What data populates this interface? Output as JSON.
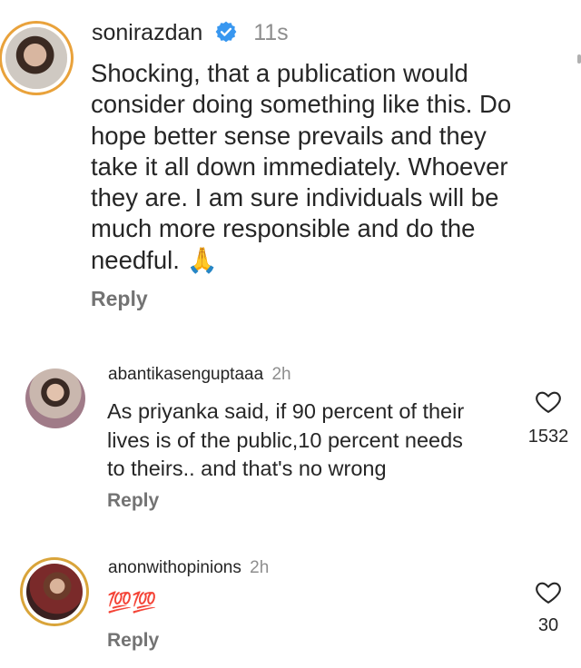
{
  "comments": [
    {
      "username": "sonirazdan",
      "verified": true,
      "time": "11s",
      "text": "Shocking, that a publication would\nconsider doing something like this. Do\nhope better sense prevails and they\ntake it all down immediately. Whoever\nthey are.  I am sure individuals will be\nmuch more responsible and do the\nneedful. 🙏",
      "reply_label": "Reply"
    },
    {
      "username": "abantikasenguptaaa",
      "time": "2h",
      "text": "As priyanka said, if 90 percent of their\nlives is of the public,10 percent needs\nto theirs.. and that's no wrong",
      "reply_label": "Reply",
      "likes": "1532"
    },
    {
      "username": "anonwithopinions",
      "time": "2h",
      "text": "💯💯",
      "reply_label": "Reply",
      "likes": "30"
    }
  ],
  "icons": {
    "verified": "verified-badge-icon",
    "like": "heart-outline-icon"
  },
  "colors": {
    "text": "#262626",
    "muted": "#737373",
    "verified_blue": "#3897f0",
    "story_ring": "#e9a23b"
  }
}
